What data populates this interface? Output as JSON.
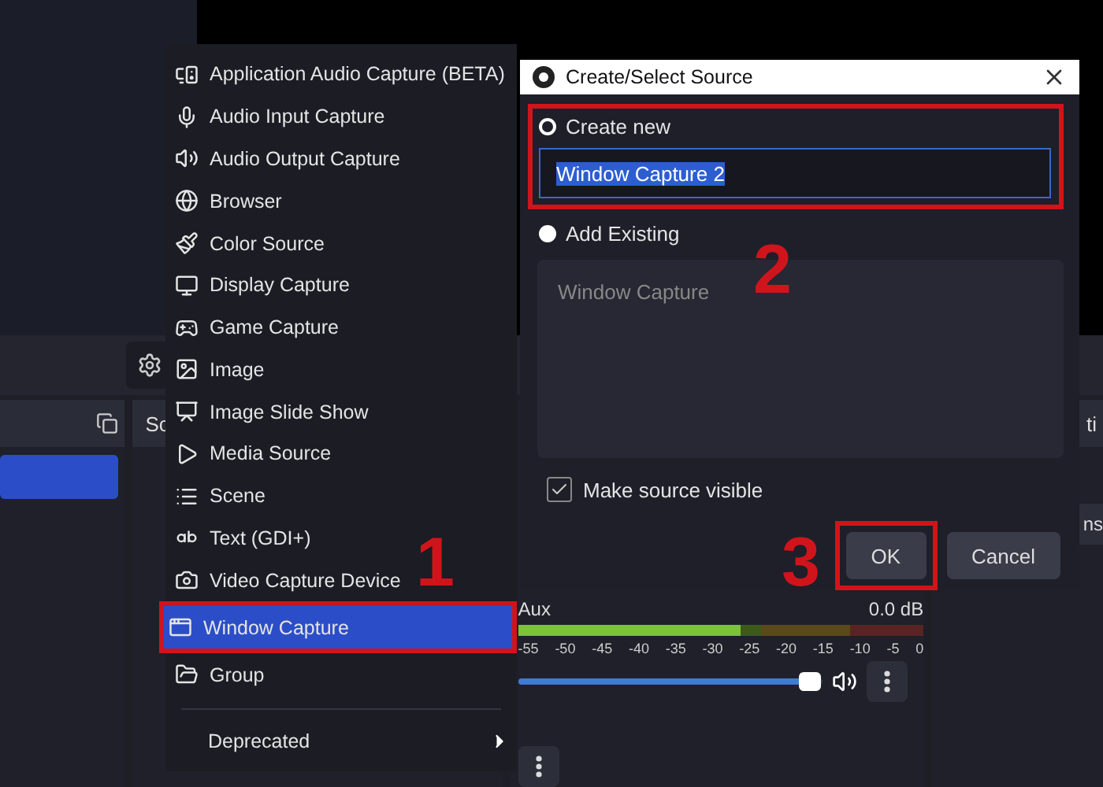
{
  "menu": {
    "items": [
      {
        "label": "Application Audio Capture (BETA)",
        "selected": false
      },
      {
        "label": "Audio Input Capture",
        "selected": false
      },
      {
        "label": "Audio Output Capture",
        "selected": false
      },
      {
        "label": "Browser",
        "selected": false
      },
      {
        "label": "Color Source",
        "selected": false
      },
      {
        "label": "Display Capture",
        "selected": false
      },
      {
        "label": "Game Capture",
        "selected": false
      },
      {
        "label": "Image",
        "selected": false
      },
      {
        "label": "Image Slide Show",
        "selected": false
      },
      {
        "label": "Media Source",
        "selected": false
      },
      {
        "label": "Scene",
        "selected": false
      },
      {
        "label": "Text (GDI+)",
        "selected": false
      },
      {
        "label": "Video Capture Device",
        "selected": false
      },
      {
        "label": "Window Capture",
        "selected": true
      },
      {
        "label": "Group",
        "selected": false
      }
    ],
    "submenu": "Deprecated"
  },
  "dialog": {
    "title": "Create/Select Source",
    "create_new": {
      "label": "Create new",
      "selected": true
    },
    "name_field": {
      "value": "Window Capture 2"
    },
    "add_existing": {
      "label": "Add Existing",
      "selected": false
    },
    "existing_list": [
      "Window Capture"
    ],
    "make_visible": {
      "label": "Make source visible",
      "checked": true
    },
    "buttons": [
      "OK",
      "Cancel"
    ]
  },
  "sources_panel": {
    "title": "Sc"
  },
  "mixer": {
    "channel": "Aux",
    "reading": "0.0 dB",
    "ticks": [
      "-55",
      "-50",
      "-45",
      "-40",
      "-35",
      "-30",
      "-25",
      "-20",
      "-15",
      "-10",
      "-5",
      "0"
    ],
    "volume": {
      "level": 0.96
    }
  },
  "right_panel": {
    "title": "ti",
    "button": "ns"
  },
  "annotations": [
    "1",
    "2",
    "3"
  ]
}
